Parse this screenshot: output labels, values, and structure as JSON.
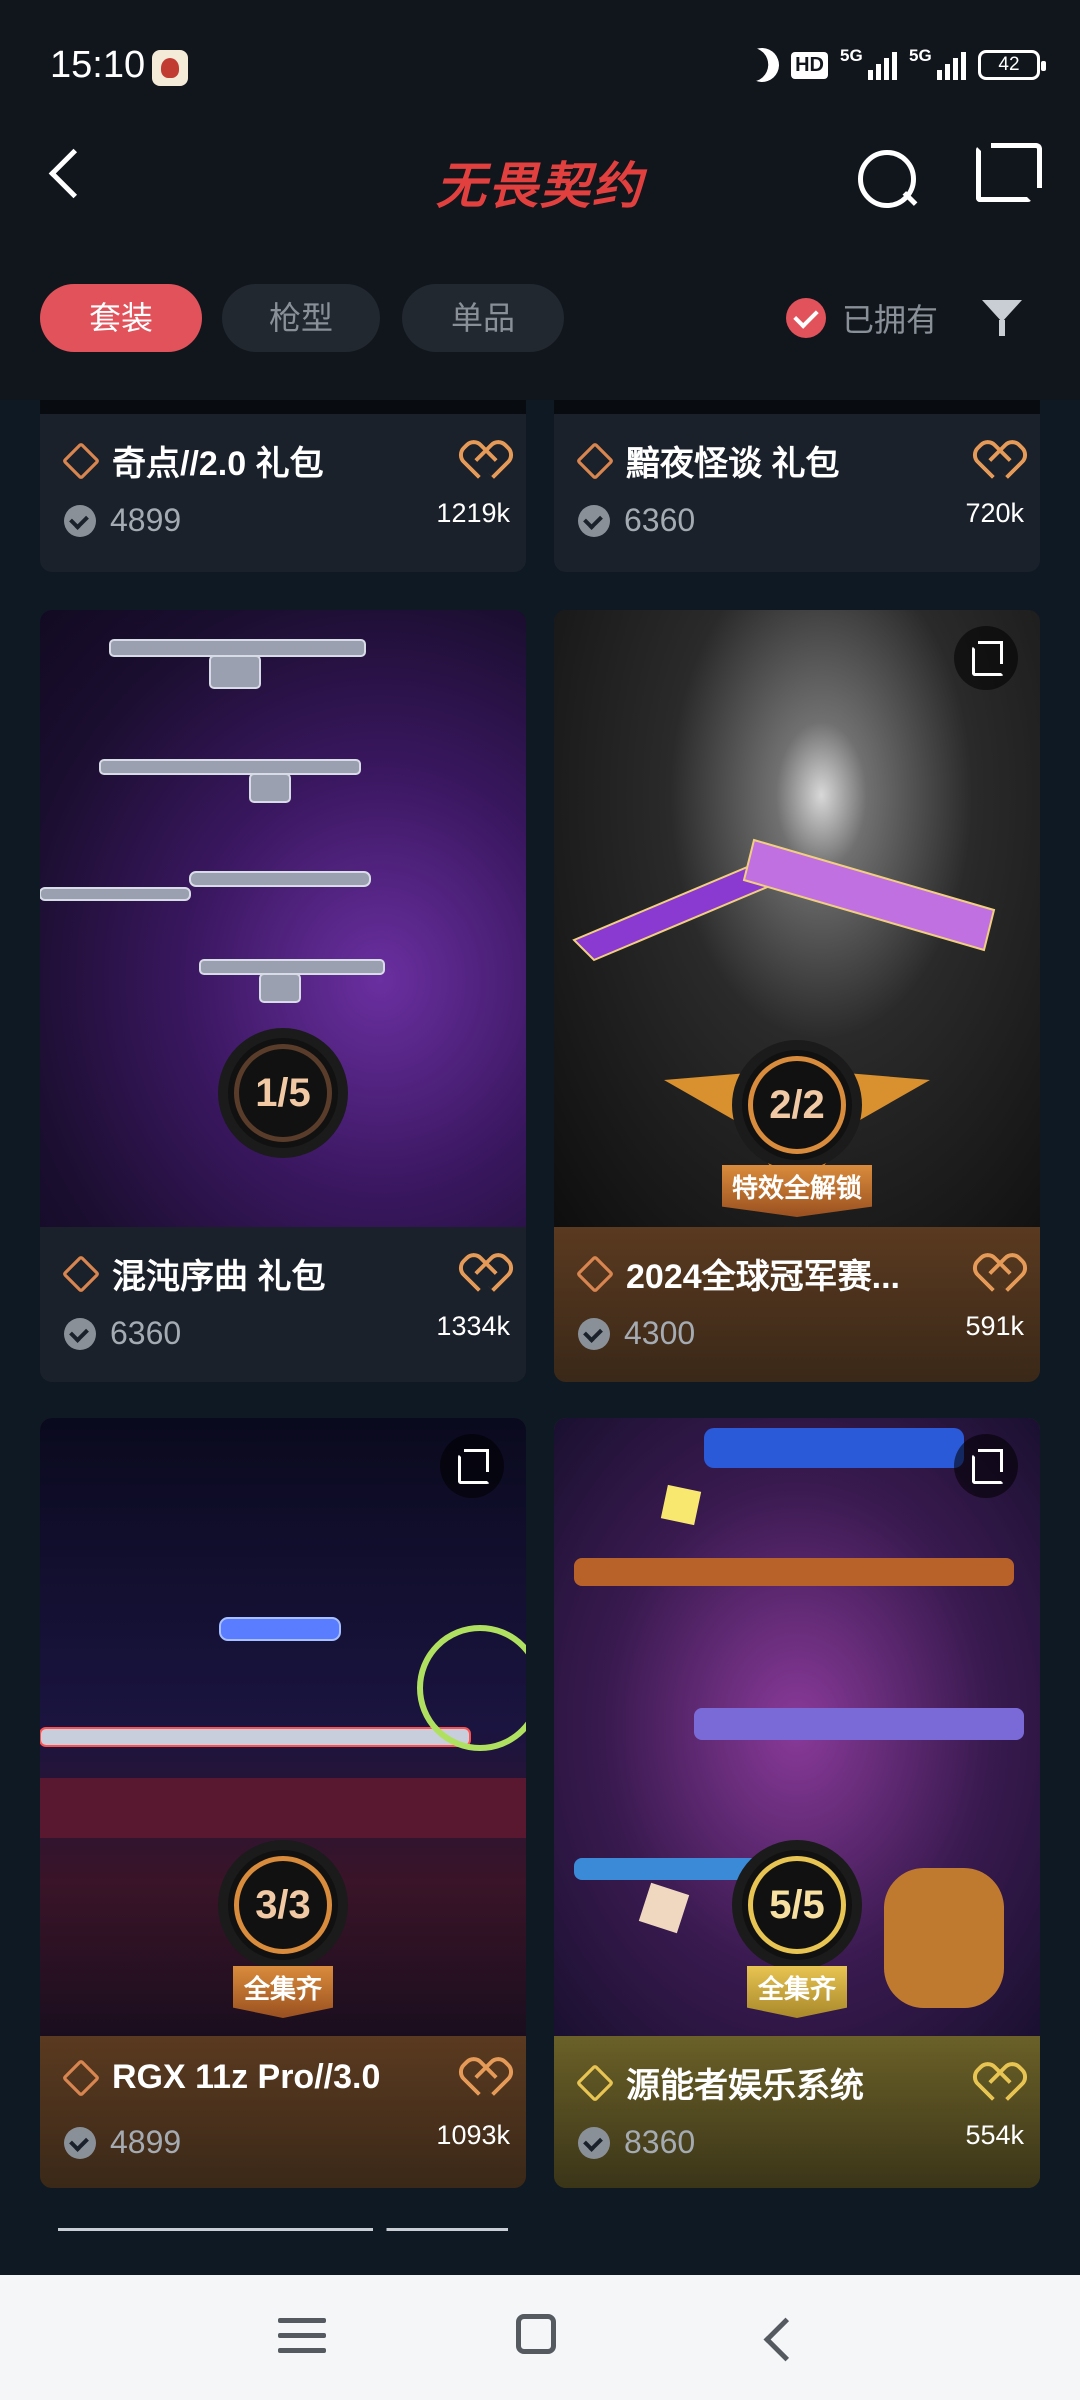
{
  "status_bar": {
    "time": "15:10",
    "network_badge": "HD",
    "signal_1": "5G",
    "signal_2": "5G",
    "battery": "42",
    "icons": [
      "app-notification-icon",
      "moon-icon",
      "hd-icon",
      "signal-icon",
      "signal-icon",
      "battery-icon"
    ]
  },
  "header": {
    "logo": "无畏契约",
    "icons": [
      "back-arrow-icon",
      "search-icon",
      "share-icon"
    ]
  },
  "filters": {
    "tabs": [
      {
        "label": "套装",
        "active": true
      },
      {
        "label": "枪型",
        "active": false
      },
      {
        "label": "单品",
        "active": false
      }
    ],
    "owned_label": "已拥有",
    "owned_checked": true,
    "filter_icon": "funnel-icon"
  },
  "cards": [
    {
      "name": "奇点//2.0 礼包",
      "price": "4899",
      "count": "1219k"
    },
    {
      "name": "黯夜怪谈 礼包",
      "price": "6360",
      "count": "720k"
    },
    {
      "name": "混沌序曲 礼包",
      "price": "6360",
      "count": "1334k",
      "progress": "1/5",
      "progress_fraction": 0.2
    },
    {
      "name": "2024全球冠军赛...",
      "price": "4300",
      "count": "591k",
      "progress": "2/2",
      "progress_fraction": 1.0,
      "ribbon": "特效全解锁"
    },
    {
      "name": "RGX 11z Pro//3.0",
      "price": "4899",
      "count": "1093k",
      "progress": "3/3",
      "progress_fraction": 1.0,
      "ribbon": "全集齐"
    },
    {
      "name": "源能者娱乐系统",
      "price": "8360",
      "count": "554k",
      "progress": "5/5",
      "progress_fraction": 1.0,
      "ribbon": "全集齐"
    }
  ],
  "colors": {
    "accent": "#e2525a",
    "logo": "#e2403f",
    "background": "#0f1923",
    "heart": "#e59a58",
    "gold": "#e8c452"
  },
  "navbar": {
    "icons": [
      "menu-icon",
      "home-icon",
      "back-icon"
    ]
  }
}
